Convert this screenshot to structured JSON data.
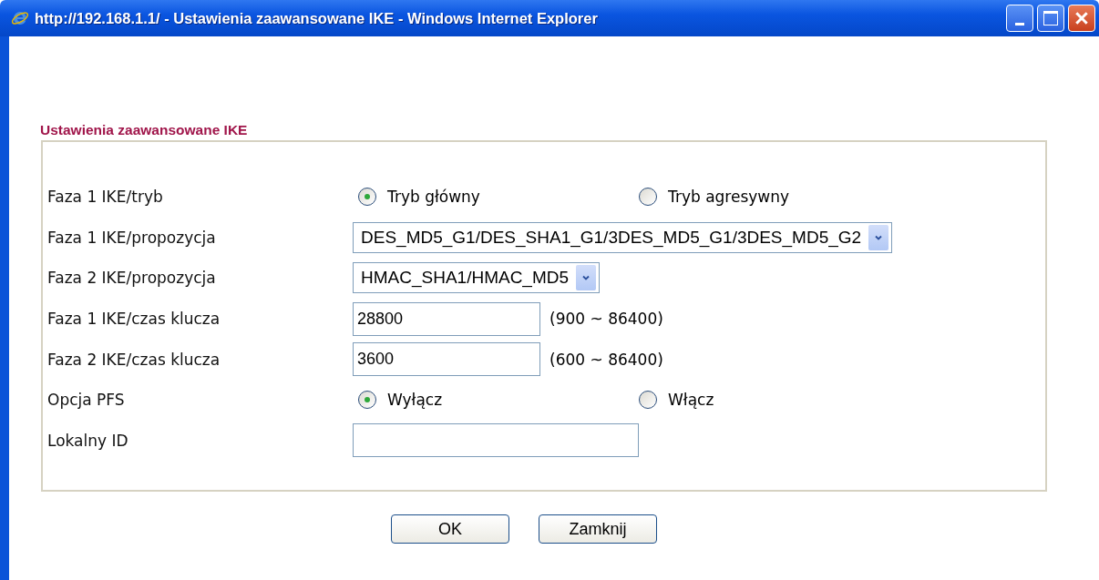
{
  "window": {
    "title": "http://192.168.1.1/ - Ustawienia zaawansowane IKE - Windows Internet Explorer"
  },
  "section": {
    "title": "Ustawienia zaawansowane IKE"
  },
  "rows": [
    {
      "label": "Faza 1 IKE/tryb",
      "kind": "radio",
      "options": [
        {
          "label": "Tryb główny",
          "selected": true
        },
        {
          "label": "Tryb agresywny",
          "selected": false
        }
      ]
    },
    {
      "label": "Faza 1 IKE/propozycja",
      "kind": "select",
      "value": "DES_MD5_G1/DES_SHA1_G1/3DES_MD5_G1/3DES_MD5_G2"
    },
    {
      "label": "Faza 2 IKE/propozycja",
      "kind": "select",
      "value": "HMAC_SHA1/HMAC_MD5"
    },
    {
      "label": "Faza 1 IKE/czas klucza",
      "kind": "text",
      "value": "28800",
      "range": "(900 ~ 86400)"
    },
    {
      "label": "Faza 2 IKE/czas klucza",
      "kind": "text",
      "value": "3600",
      "range": "(600 ~ 86400)"
    },
    {
      "label": "Opcja PFS",
      "kind": "radio",
      "options": [
        {
          "label": "Wyłącz",
          "selected": true
        },
        {
          "label": "Włącz",
          "selected": false
        }
      ]
    },
    {
      "label": "Lokalny ID",
      "kind": "wide-text",
      "value": ""
    }
  ],
  "buttons": [
    "OK",
    "Zamknij"
  ]
}
